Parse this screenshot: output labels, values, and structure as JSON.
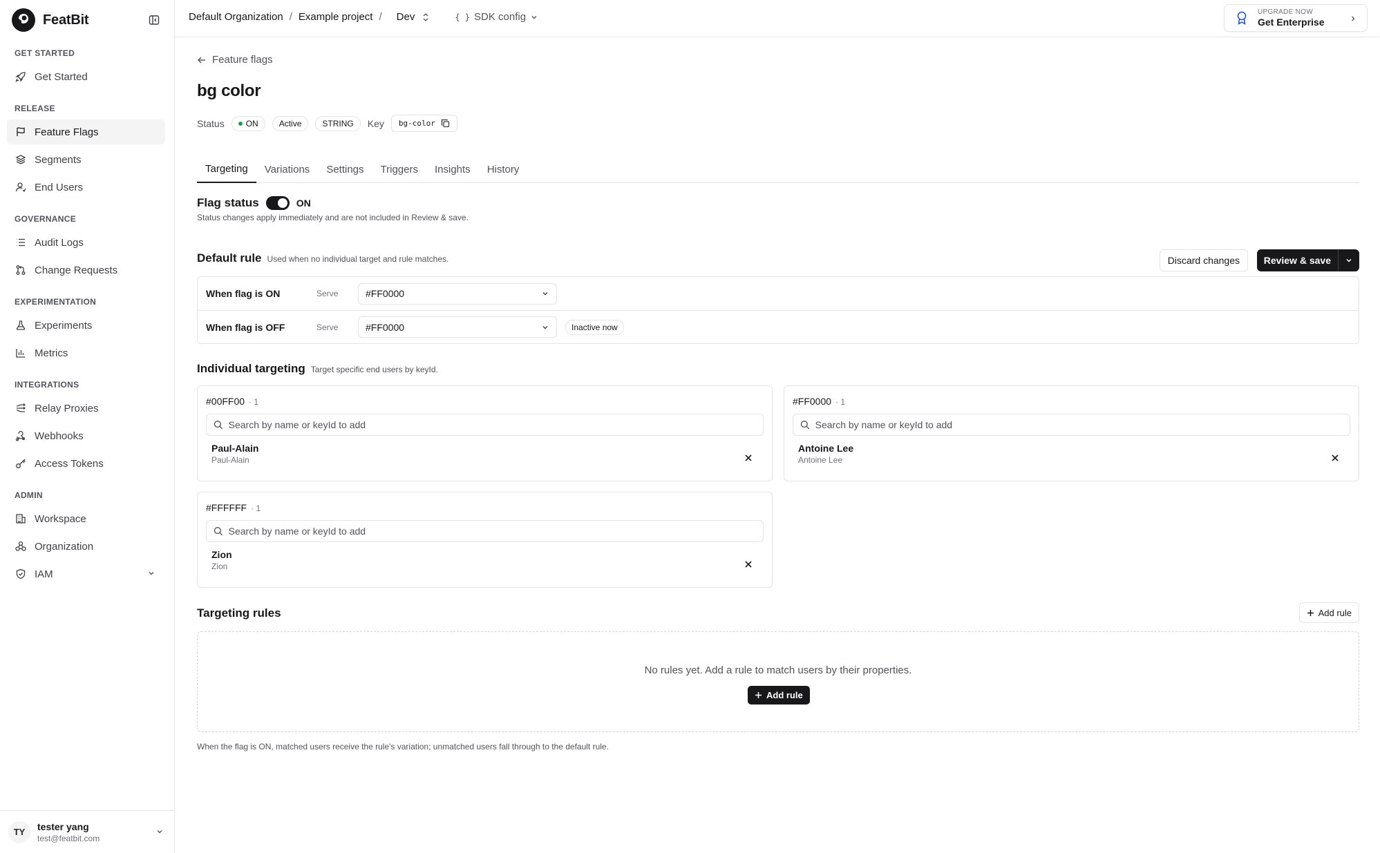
{
  "brand": {
    "name": "FeatBit"
  },
  "sidebar": {
    "sections": [
      {
        "label": "GET STARTED"
      },
      {
        "label": "RELEASE"
      },
      {
        "label": "GOVERNANCE"
      },
      {
        "label": "EXPERIMENTATION"
      },
      {
        "label": "INTEGRATIONS"
      },
      {
        "label": "ADMIN"
      }
    ],
    "items": [
      {
        "label": "Get Started",
        "icon": "rocket-icon"
      },
      {
        "label": "Feature Flags",
        "icon": "flag-icon",
        "active": true
      },
      {
        "label": "Segments",
        "icon": "layers-icon"
      },
      {
        "label": "End Users",
        "icon": "user-icon"
      },
      {
        "label": "Audit Logs",
        "icon": "list-icon"
      },
      {
        "label": "Change Requests",
        "icon": "git-pull-request-icon"
      },
      {
        "label": "Experiments",
        "icon": "flask-icon"
      },
      {
        "label": "Metrics",
        "icon": "bar-chart-icon"
      },
      {
        "label": "Relay Proxies",
        "icon": "relay-icon"
      },
      {
        "label": "Webhooks",
        "icon": "webhook-icon"
      },
      {
        "label": "Access Tokens",
        "icon": "key-icon"
      },
      {
        "label": "Workspace",
        "icon": "building-icon"
      },
      {
        "label": "Organization",
        "icon": "organization-icon"
      },
      {
        "label": "IAM",
        "icon": "shield-icon"
      }
    ],
    "user": {
      "initials": "TY",
      "name": "tester yang",
      "email": "test@featbit.com"
    }
  },
  "topbar": {
    "breadcrumbs": [
      "Default Organization",
      "Example project"
    ],
    "separator": "/",
    "environment": "Dev",
    "sdk_config": "SDK config",
    "upgrade": {
      "small": "UPGRADE NOW",
      "big": "Get Enterprise"
    }
  },
  "flag": {
    "back_label": "Feature flags",
    "title": "bg color",
    "status_label": "Status",
    "status_value": "ON",
    "state_badge": "Active",
    "type_badge": "STRING",
    "key_label": "Key",
    "key_value": "bg-color"
  },
  "tabs": [
    {
      "label": "Targeting",
      "active": true
    },
    {
      "label": "Variations"
    },
    {
      "label": "Settings"
    },
    {
      "label": "Triggers"
    },
    {
      "label": "Insights"
    },
    {
      "label": "History"
    }
  ],
  "flag_status": {
    "title": "Flag status",
    "toggle_value": "ON",
    "hint": "Status changes apply immediately and are not included in Review & save."
  },
  "default_rule": {
    "title": "Default rule",
    "hint": "Used when no individual target and rule matches.",
    "discard_label": "Discard changes",
    "review_label": "Review & save",
    "rows": [
      {
        "label": "When flag is ON",
        "serve": "Serve",
        "value": "#FF0000"
      },
      {
        "label": "When flag is OFF",
        "serve": "Serve",
        "value": "#FF0000",
        "badge": "Inactive now"
      }
    ]
  },
  "individual": {
    "title": "Individual targeting",
    "hint": "Target specific end users by keyId.",
    "search_placeholder": "Search by name or keyId to add",
    "cards": [
      {
        "variation": "#00FF00",
        "count": "· 1",
        "user_name": "Paul-Alain",
        "user_key": "Paul-Alain"
      },
      {
        "variation": "#FF0000",
        "count": "· 1",
        "user_name": "Antoine Lee",
        "user_key": "Antoine Lee"
      },
      {
        "variation": "#FFFFFF",
        "count": "· 1",
        "user_name": "Zion",
        "user_key": "Zion"
      }
    ]
  },
  "targeting_rules": {
    "title": "Targeting rules",
    "add_label": "Add rule",
    "empty_text": "No rules yet. Add a rule to match users by their properties.",
    "footnote": "When the flag is ON, matched users receive the rule's variation; unmatched users fall through to the default rule."
  },
  "colors": {
    "primary": "#18181b",
    "border": "#e4e4e7",
    "status_on": "#16a34a",
    "muted": "#52525b"
  }
}
